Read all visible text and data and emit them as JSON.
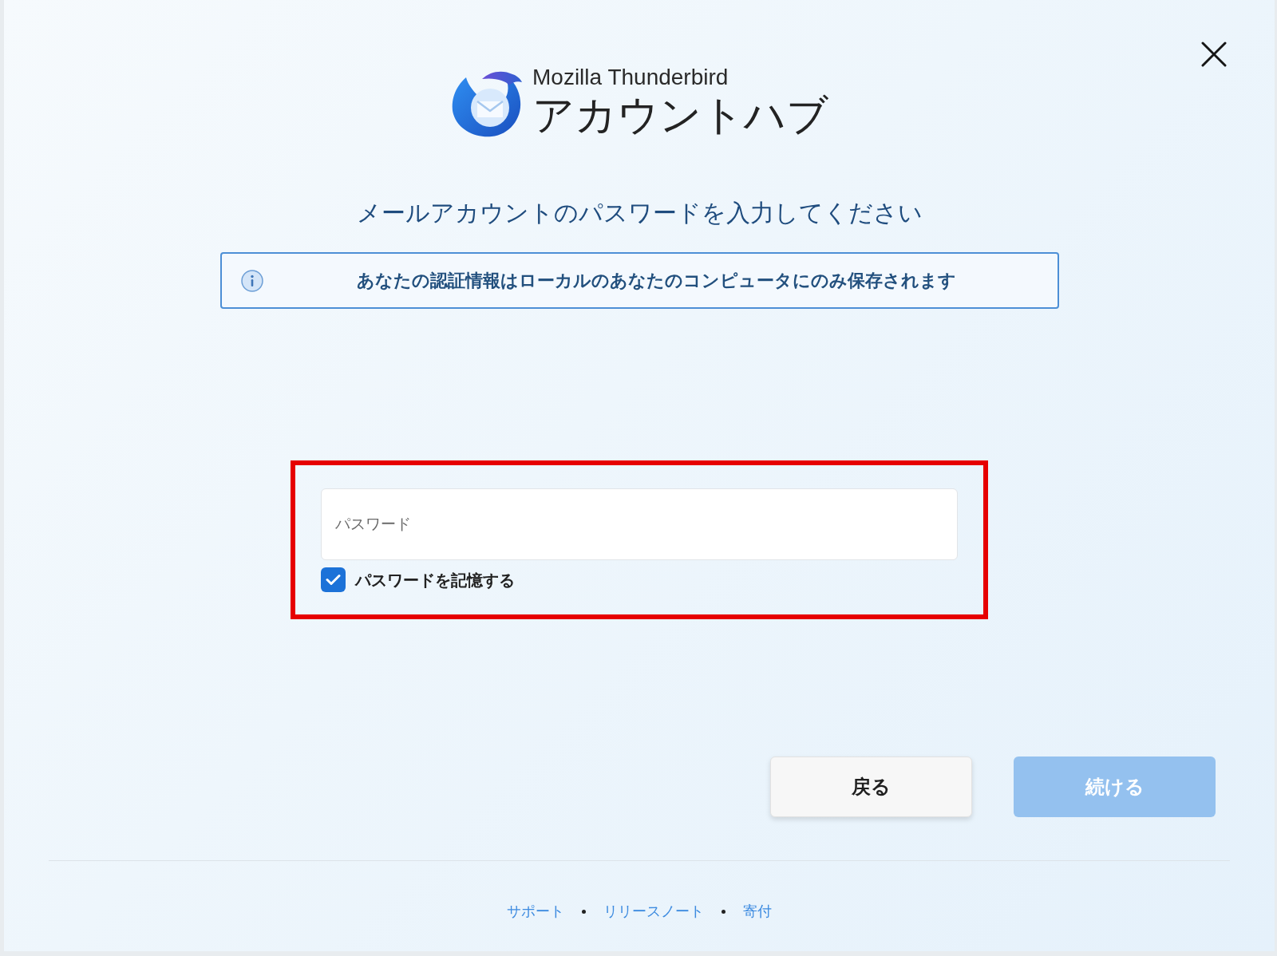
{
  "app": {
    "brand": "Mozilla Thunderbird",
    "title": "アカウントハブ"
  },
  "heading": "メールアカウントのパスワードを入力してください",
  "notice": {
    "text": "あなたの認証情報はローカルのあなたのコンピュータにのみ保存されます"
  },
  "form": {
    "highlighted": true,
    "password": {
      "placeholder": "パスワード"
    },
    "remember": {
      "label": "パスワードを記憶する",
      "checked": true
    }
  },
  "buttons": [
    {
      "label": "戻る",
      "kind": "secondary",
      "disabled": false
    },
    {
      "label": "続ける",
      "kind": "primary",
      "disabled": true
    }
  ],
  "footer_links": [
    "サポート",
    "リリースノート",
    "寄付"
  ]
}
